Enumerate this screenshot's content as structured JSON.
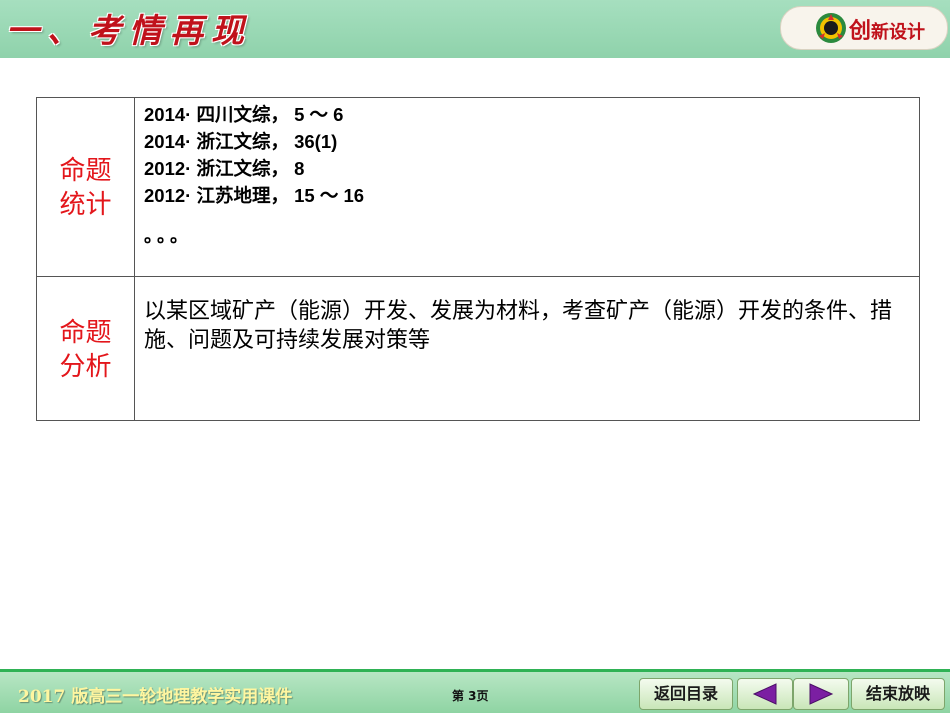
{
  "header": {
    "title": "一、考情再现",
    "brand": {
      "big": "创",
      "rest": "新设计"
    }
  },
  "table": {
    "rows": [
      {
        "label": "命题统计",
        "label_lines": [
          "命题",
          "统计"
        ],
        "items": [
          "2014· 四川文综， 5 ～ 6",
          "2014· 浙江文综， 36(1)",
          "2012· 浙江文综， 8",
          "2012· 江苏地理， 15 ～ 16"
        ],
        "trailing": "。。。"
      },
      {
        "label": "命题分析",
        "label_lines": [
          "命题",
          "分析"
        ],
        "text": "以某区域矿产（能源）开发、发展为材料，考查矿产（能源）开发的条件、措施、问题及可持续发展对策等"
      }
    ]
  },
  "footer": {
    "course": "2017 版高三一轮地理教学实用课件",
    "page": "第 3页",
    "back_label": "返回目录",
    "end_label": "结束放映",
    "prev_icon": "triangle-left-icon",
    "next_icon": "triangle-right-icon"
  },
  "colors": {
    "accent_red": "#e3161b",
    "header_green": "#8fd2ab",
    "arrow_purple": "#7b1fa2"
  }
}
